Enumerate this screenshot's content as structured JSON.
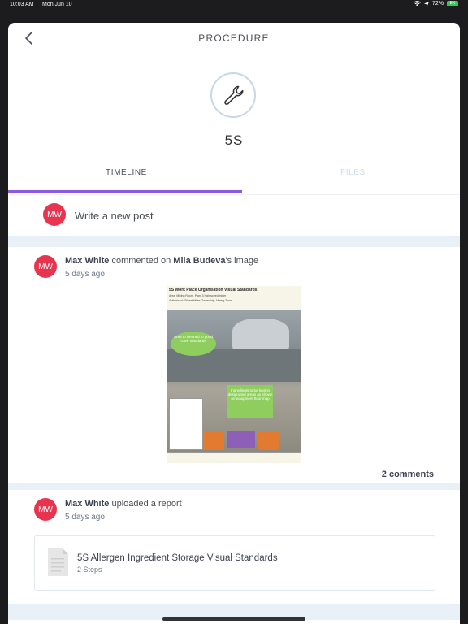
{
  "status_bar": {
    "time": "10:03 AM",
    "date": "Mon Jun 10",
    "battery_percent": "72%"
  },
  "nav": {
    "title": "PROCEDURE"
  },
  "procedure": {
    "name": "5S",
    "icon": "wrench-icon"
  },
  "tabs": [
    {
      "label": "TIMELINE",
      "active": true
    },
    {
      "label": "FILES",
      "active": false
    }
  ],
  "compose": {
    "avatar_initials": "MW",
    "placeholder": "Write a new post"
  },
  "posts": [
    {
      "avatar_initials": "MW",
      "author": "Max White",
      "action": "commented on",
      "target": "Mila Budeva",
      "target_suffix": "'s image",
      "time": "5 days ago",
      "image": {
        "title": "5S Work Place Organisation Visual Standards",
        "area_line": "Area: Mixing Room, Plant 3 high speed mixer",
        "authorised_line": "Authorised: Gilbert Hilles     Ownership: Mixing Team",
        "callout_1": "Area to cleaned to good GMP standards",
        "callout_2": "Ingredients to be kept in designated areas as shown on equipment floor map"
      },
      "comments_label": "2 comments"
    },
    {
      "avatar_initials": "MW",
      "author": "Max White",
      "action": "uploaded a report",
      "time": "5 days ago",
      "document": {
        "title": "5S Allergen Ingredient Storage Visual Standards",
        "steps": "2 Steps"
      }
    }
  ],
  "colors": {
    "accent": "#8a5be0",
    "avatar": "#e8344f",
    "separator": "#eaf0f8"
  }
}
